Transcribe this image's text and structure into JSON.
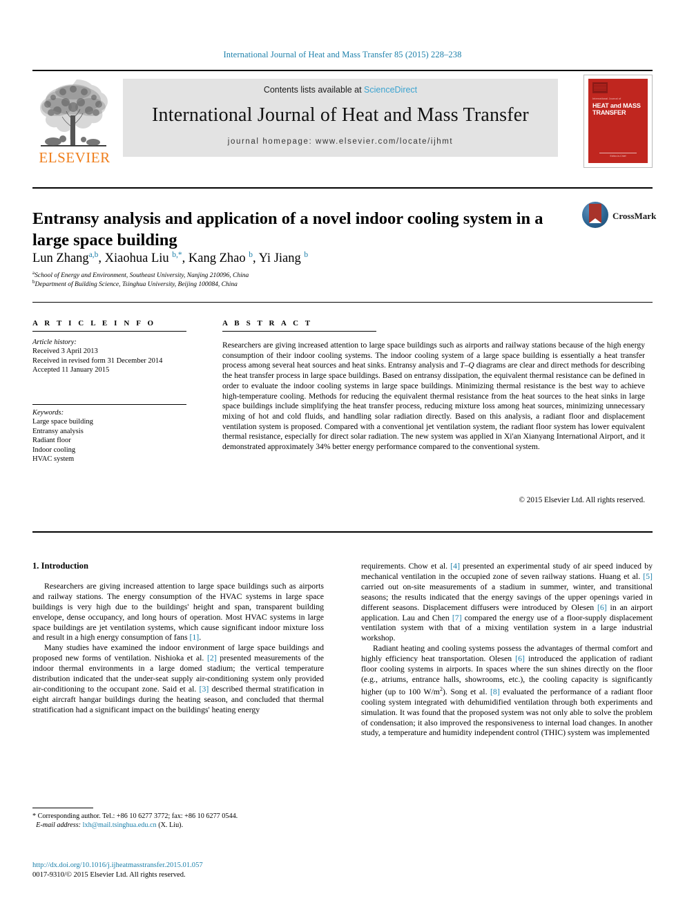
{
  "running_head": "International Journal of Heat and Mass Transfer 85 (2015) 228–238",
  "masthead": {
    "publisher_name": "ELSEVIER",
    "contents_prefix": "Contents lists available at ",
    "contents_link": "ScienceDirect",
    "journal_title": "International Journal of Heat and Mass Transfer",
    "homepage": "journal homepage: www.elsevier.com/locate/ijhmt",
    "cover": {
      "supertitle": "International Journal of",
      "line1": "HEAT and MASS",
      "line2": "TRANSFER",
      "footer": "Editor-in-Chief"
    },
    "colors": {
      "link_blue": "#3ba3d0",
      "elsevier_orange": "#ef7d1a",
      "cover_red": "#c0261f",
      "banner_gray": "#e3e3e3"
    }
  },
  "article": {
    "title": "Entransy analysis and application of a novel indoor cooling system in a large space building",
    "authors": "Lun Zhang a,b, Xiaohua Liu b,*, Kang Zhao b, Yi Jiang b",
    "author_list": [
      {
        "name": "Lun Zhang",
        "marks": "a,b"
      },
      {
        "name": "Xiaohua Liu",
        "marks": "b,*"
      },
      {
        "name": "Kang Zhao",
        "marks": "b"
      },
      {
        "name": "Yi Jiang",
        "marks": "b"
      }
    ],
    "affiliations": [
      {
        "mark": "a",
        "text": "School of Energy and Environment, Southeast University, Nanjing 210096, China"
      },
      {
        "mark": "b",
        "text": "Department of Building Science, Tsinghua University, Beijing 100084, China"
      }
    ],
    "crossmark_label": "CrossMark"
  },
  "info": {
    "heading": "A R T I C L E    I N F O",
    "history_label": "Article history:",
    "history": [
      "Received 3 April 2013",
      "Received in revised form 31 December 2014",
      "Accepted 11 January 2015"
    ],
    "keywords_label": "Keywords:",
    "keywords": [
      "Large space building",
      "Entransy analysis",
      "Radiant floor",
      "Indoor cooling",
      "HVAC system"
    ]
  },
  "abstract": {
    "heading": "A B S T R A C T",
    "text": "Researchers are giving increased attention to large space buildings such as airports and railway stations because of the high energy consumption of their indoor cooling systems. The indoor cooling system of a large space building is essentially a heat transfer process among several heat sources and heat sinks. Entransy analysis and T–Q diagrams are clear and direct methods for describing the heat transfer process in large space buildings. Based on entransy dissipation, the equivalent thermal resistance can be defined in order to evaluate the indoor cooling systems in large space buildings. Minimizing thermal resistance is the best way to achieve high-temperature cooling. Methods for reducing the equivalent thermal resistance from the heat sources to the heat sinks in large space buildings include simplifying the heat transfer process, reducing mixture loss among heat sources, minimizing unnecessary mixing of hot and cold fluids, and handling solar radiation directly. Based on this analysis, a radiant floor and displacement ventilation system is proposed. Compared with a conventional jet ventilation system, the radiant floor system has lower equivalent thermal resistance, especially for direct solar radiation. The new system was applied in Xi'an Xianyang International Airport, and it demonstrated approximately 34% better energy performance compared to the conventional system.",
    "copyright": "© 2015 Elsevier Ltd. All rights reserved."
  },
  "body": {
    "section_heading": "1. Introduction",
    "left_p1": "Researchers are giving increased attention to large space buildings such as airports and railway stations. The energy consumption of the HVAC systems in large space buildings is very high due to the buildings' height and span, transparent building envelope, dense occupancy, and long hours of operation. Most HVAC systems in large space buildings are jet ventilation systems, which cause significant indoor mixture loss and result in a high energy consumption of fans [1].",
    "left_p2": "Many studies have examined the indoor environment of large space buildings and proposed new forms of ventilation. Nishioka et al. [2] presented measurements of the indoor thermal environments in a large domed stadium; the vertical temperature distribution indicated that the under-seat supply air-conditioning system only provided air-conditioning to the occupant zone. Said et al. [3] described thermal stratification in eight aircraft hangar buildings during the heating season, and concluded that thermal stratification had a significant impact on the buildings' heating energy",
    "right_p1": "requirements. Chow et al. [4] presented an experimental study of air speed induced by mechanical ventilation in the occupied zone of seven railway stations. Huang et al. [5] carried out on-site measurements of a stadium in summer, winter, and transitional seasons; the results indicated that the energy savings of the upper openings varied in different seasons. Displacement diffusers were introduced by Olesen [6] in an airport application. Lau and Chen [7] compared the energy use of a floor-supply displacement ventilation system with that of a mixing ventilation system in a large industrial workshop.",
    "right_p2": "Radiant heating and cooling systems possess the advantages of thermal comfort and highly efficiency heat transportation. Olesen [6] introduced the application of radiant floor cooling systems in airports. In spaces where the sun shines directly on the floor (e.g., atriums, entrance halls, showrooms, etc.), the cooling capacity is significantly higher (up to 100 W/m2). Song et al. [8] evaluated the performance of a radiant floor cooling system integrated with dehumidified ventilation through both experiments and simulation. It was found that the proposed system was not only able to solve the problem of condensation; it also improved the responsiveness to internal load changes. In another study, a temperature and humidity independent control (THIC) system was implemented"
  },
  "footnote": {
    "corresponding": "* Corresponding author. Tel.: +86 10 6277 3772; fax: +86 10 6277 0544.",
    "email_label": "E-mail address:",
    "email": "lxh@mail.tsinghua.edu.cn",
    "email_suffix": "(X. Liu)."
  },
  "publication": {
    "doi": "http://dx.doi.org/10.1016/j.ijheatmasstransfer.2015.01.057",
    "issn_line": "0017-9310/© 2015 Elsevier Ltd. All rights reserved."
  }
}
